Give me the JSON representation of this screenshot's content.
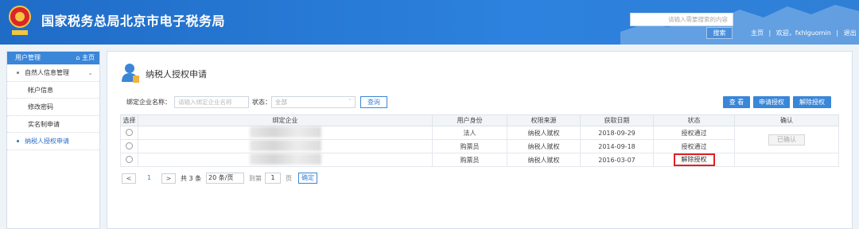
{
  "header": {
    "title": "国家税务总局北京市电子税务局",
    "emblem_icon": "tax-emblem-icon",
    "search_placeholder": "请输入需要搜索的内容",
    "search_button": "搜索",
    "home_link": "主页",
    "welcome": "欢迎，fxhlguomin",
    "logout_link": "退出",
    "separator": "|"
  },
  "sidebar": {
    "title": "用户管理",
    "home": "主页",
    "group_label": "自然人信息管理",
    "items": [
      {
        "label": "帐户信息"
      },
      {
        "label": "修改密码"
      },
      {
        "label": "实名制申请"
      },
      {
        "label": "纳税人授权申请"
      }
    ]
  },
  "main": {
    "title": "纳税人授权申请",
    "filter": {
      "company_label": "绑定企业名称：",
      "company_placeholder": "请输入绑定企业名称",
      "status_label": "状态：",
      "status_value": "全部",
      "query_button": "查询"
    },
    "actions": {
      "view": "查 看",
      "apply": "申请授权",
      "revoke": "解除授权"
    },
    "table": {
      "columns": [
        "选择",
        "绑定企业",
        "用户身份",
        "权限来源",
        "获取日期",
        "状态",
        "确认"
      ],
      "rows": [
        {
          "identity": "法人",
          "source": "纳税人赋权",
          "date": "2018-09-29",
          "status": "授权通过",
          "confirm": "已确认"
        },
        {
          "identity": "购票员",
          "source": "纳税人赋权",
          "date": "2014-09-18",
          "status": "授权通过",
          "confirm": ""
        },
        {
          "identity": "购票员",
          "source": "纳税人赋权",
          "date": "2016-03-07",
          "status": "解除授权",
          "confirm": ""
        }
      ]
    },
    "pager": {
      "prev": "<",
      "page": "1",
      "next": ">",
      "total": "共 3 条",
      "page_size": "20 条/页",
      "goto_label": "到第",
      "goto_value": "1",
      "page_suffix": "页",
      "confirm": "确定"
    }
  },
  "colors": {
    "brand": "#2c82de",
    "accent": "#3a86d8",
    "highlight": "#e0211f"
  }
}
